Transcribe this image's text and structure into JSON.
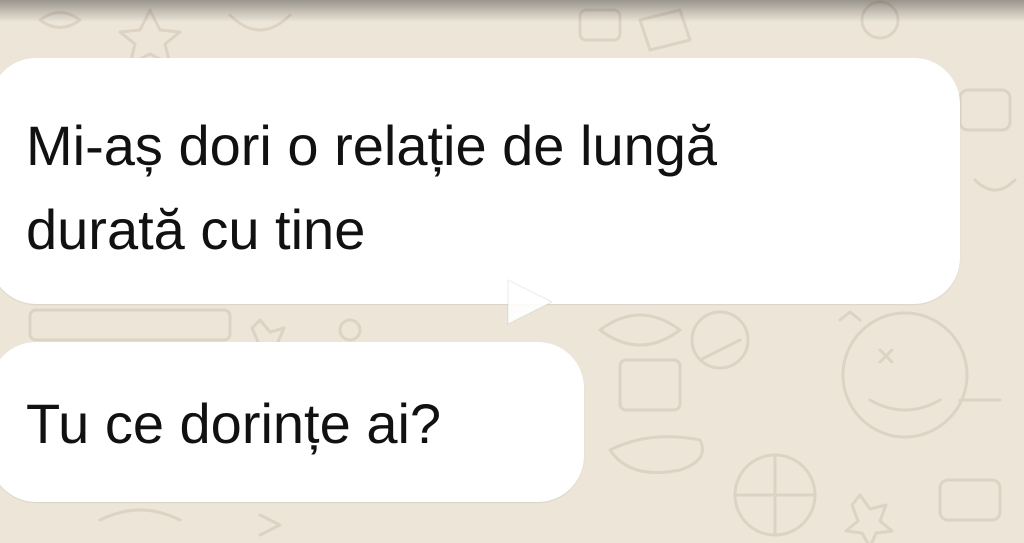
{
  "chat": {
    "messages": [
      {
        "text": "Mi-aș dori o relație de lungă durată cu tine"
      },
      {
        "text": "Tu ce dorințe ai?"
      }
    ]
  },
  "icons": {
    "play": "play-icon"
  },
  "colors": {
    "wallpaper": "#ece5d8",
    "bubble": "#ffffff",
    "text": "#111111"
  }
}
